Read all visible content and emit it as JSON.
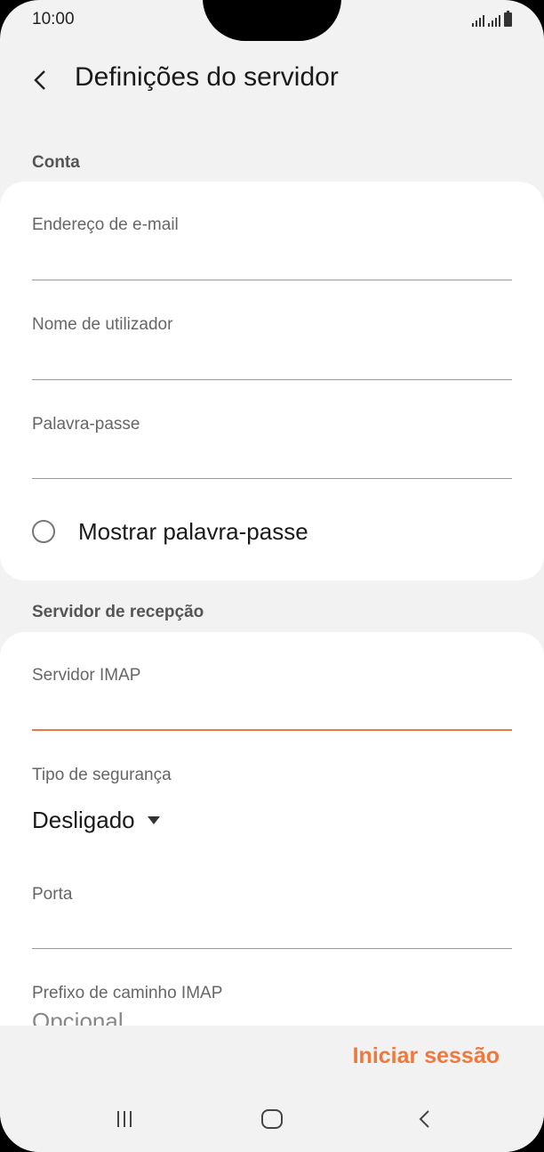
{
  "status_bar": {
    "time": "10:00"
  },
  "header": {
    "title": "Definições do servidor"
  },
  "conta": {
    "section_title": "Conta",
    "email_label": "Endereço de e-mail",
    "email_value": "",
    "username_label": "Nome de utilizador",
    "username_value": "",
    "password_label": "Palavra-passe",
    "password_value": "",
    "show_password_label": "Mostrar palavra-passe"
  },
  "incoming": {
    "section_title": "Servidor de recepção",
    "imap_label": "Servidor IMAP",
    "imap_value": "",
    "security_label": "Tipo de segurança",
    "security_value": "Desligado",
    "port_label": "Porta",
    "port_value": "",
    "prefix_label": "Prefixo de caminho IMAP",
    "prefix_placeholder": "Opcional"
  },
  "footer": {
    "signin_label": "Iniciar sessão"
  },
  "colors": {
    "accent": "#f0783c",
    "background": "#f2f2f2",
    "card": "#ffffff"
  }
}
